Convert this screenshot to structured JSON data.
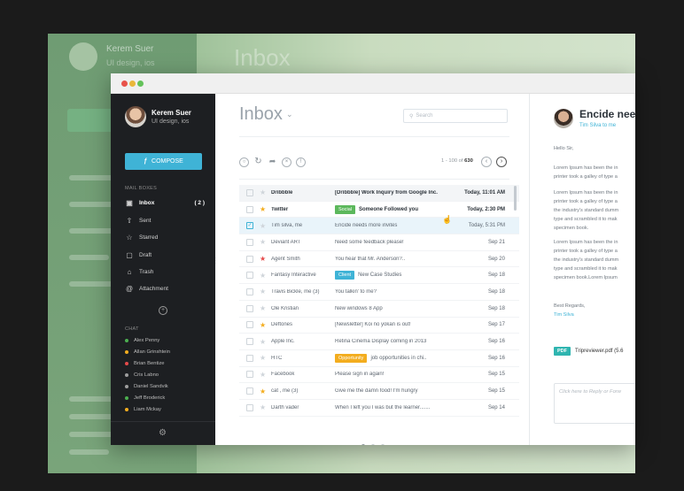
{
  "background": {
    "name": "Kerem Suer",
    "role": "UI design, ios",
    "title": "Inbox"
  },
  "app": {
    "user": {
      "name": "Kerem Suer",
      "role": "UI design, ios"
    },
    "compose_label": "COMPOSE",
    "mailboxes_label": "MAIL BOXES",
    "nav": [
      {
        "label": "Inbox",
        "count": "( 2 )",
        "icon": "inbox-icon"
      },
      {
        "label": "Sent",
        "count": "",
        "icon": "sent-icon"
      },
      {
        "label": "Starred",
        "count": "",
        "icon": "star-icon"
      },
      {
        "label": "Draft",
        "count": "",
        "icon": "draft-icon"
      },
      {
        "label": "Trash",
        "count": "",
        "icon": "trash-icon"
      },
      {
        "label": "Attachment",
        "count": "",
        "icon": "attachment-icon"
      }
    ],
    "chat_label": "CHAT",
    "chat": [
      {
        "name": "Alex Penny",
        "status_color": "#4caf50"
      },
      {
        "name": "Allan Grinshtein",
        "status_color": "#f3ad1f"
      },
      {
        "name": "Brian Bentize",
        "status_color": "#e54a4a"
      },
      {
        "name": "Cris Labno",
        "status_color": "#9e9e9e"
      },
      {
        "name": "Daniel Sandvik",
        "status_color": "#9e9e9e"
      },
      {
        "name": "Jeff Broderick",
        "status_color": "#4caf50"
      },
      {
        "name": "Liam Mckay",
        "status_color": "#f3ad1f"
      }
    ]
  },
  "list": {
    "title": "Inbox",
    "search_placeholder": "Search",
    "pagination": {
      "prefix": "1 - 100 of",
      "total": "630"
    },
    "emails": [
      {
        "sender": "Dribbble",
        "subject": "[Dribbble] Work Inquiry from Google Inc.",
        "tag": "",
        "tag_color": "",
        "date": "Today, 11:01 AM",
        "star": "none",
        "bold": true,
        "checked": false
      },
      {
        "sender": "Twitter",
        "subject": "Someone Followed you",
        "tag": "Social",
        "tag_color": "#5cb85c",
        "date": "Today, 2:30 PM",
        "star": "gold",
        "bold": true,
        "checked": false
      },
      {
        "sender": "Tim silva, me",
        "subject": "Encide needs more invites",
        "tag": "",
        "tag_color": "",
        "date": "Today, 5:31 PM",
        "star": "none",
        "bold": false,
        "checked": true
      },
      {
        "sender": "Deviant ART",
        "subject": "Need some feedback please!",
        "tag": "",
        "tag_color": "",
        "date": "Sep 21",
        "star": "none",
        "bold": false,
        "checked": false
      },
      {
        "sender": "Agent Smith",
        "subject": "You hear that Mr. Anderson?..",
        "tag": "",
        "tag_color": "",
        "date": "Sep 20",
        "star": "red",
        "bold": false,
        "checked": false
      },
      {
        "sender": "Fantasy Interactive",
        "subject": "New Case Studies",
        "tag": "Client",
        "tag_color": "#3fb3d6",
        "date": "Sep 18",
        "star": "none",
        "bold": false,
        "checked": false
      },
      {
        "sender": "Travis Bickle, me (3)",
        "subject": "You talkin' to me?",
        "tag": "",
        "tag_color": "",
        "date": "Sep 18",
        "star": "none",
        "bold": false,
        "checked": false
      },
      {
        "sender": "Ole Kristian",
        "subject": "New windows 8 App",
        "tag": "",
        "tag_color": "",
        "date": "Sep 18",
        "star": "none",
        "bold": false,
        "checked": false
      },
      {
        "sender": "Deftones",
        "subject": "[Newsletter] Koi no yokan is out!",
        "tag": "",
        "tag_color": "",
        "date": "Sep 17",
        "star": "gold",
        "bold": false,
        "checked": false
      },
      {
        "sender": "Apple Inc.",
        "subject": "Retina Cinema Display coming in 2013",
        "tag": "",
        "tag_color": "",
        "date": "Sep 16",
        "star": "none",
        "bold": false,
        "checked": false
      },
      {
        "sender": "HTC",
        "subject": "job opportunities in chi..",
        "tag": "Opportunity",
        "tag_color": "#f3ad1f",
        "date": "Sep 16",
        "star": "none",
        "bold": false,
        "checked": false
      },
      {
        "sender": "Facebook",
        "subject": "Please sign in again!",
        "tag": "",
        "tag_color": "",
        "date": "Sep 15",
        "star": "none",
        "bold": false,
        "checked": false
      },
      {
        "sender": "cat , me (3)",
        "subject": "Give me the damn food! I'm hungry",
        "tag": "",
        "tag_color": "",
        "date": "Sep 15",
        "star": "gold",
        "bold": false,
        "checked": false
      },
      {
        "sender": "Darth vader",
        "subject": "When I left you I was but the learner.......",
        "tag": "",
        "tag_color": "",
        "date": "Sep 14",
        "star": "none",
        "bold": false,
        "checked": false
      }
    ]
  },
  "reader": {
    "subject": "Encide nee",
    "from": "Tim Silva to me",
    "greeting": "Hello Sir,",
    "para1": [
      "Lorem Ipsum has been the in",
      "printer took a galley of type a"
    ],
    "para2": [
      "Lorem Ipsum has been the in",
      "printer took a galley of type a",
      "the industry's standard dumm",
      "type and scrambled it to mak",
      "specimen book."
    ],
    "para3": [
      "Lorem Ipsum has been the in",
      "printer took a galley of type a",
      "the industry's standard dumm",
      "type and scrambled it to mak",
      "specimen book.Lorem Ipsum"
    ],
    "regards": "Best Regards,",
    "signature": "Tim Silva",
    "attachment_badge": "PDF",
    "attachment_name": "Tripreviewer.pdf (5.6",
    "reply_placeholder": "Click here to Reply or Forw"
  }
}
